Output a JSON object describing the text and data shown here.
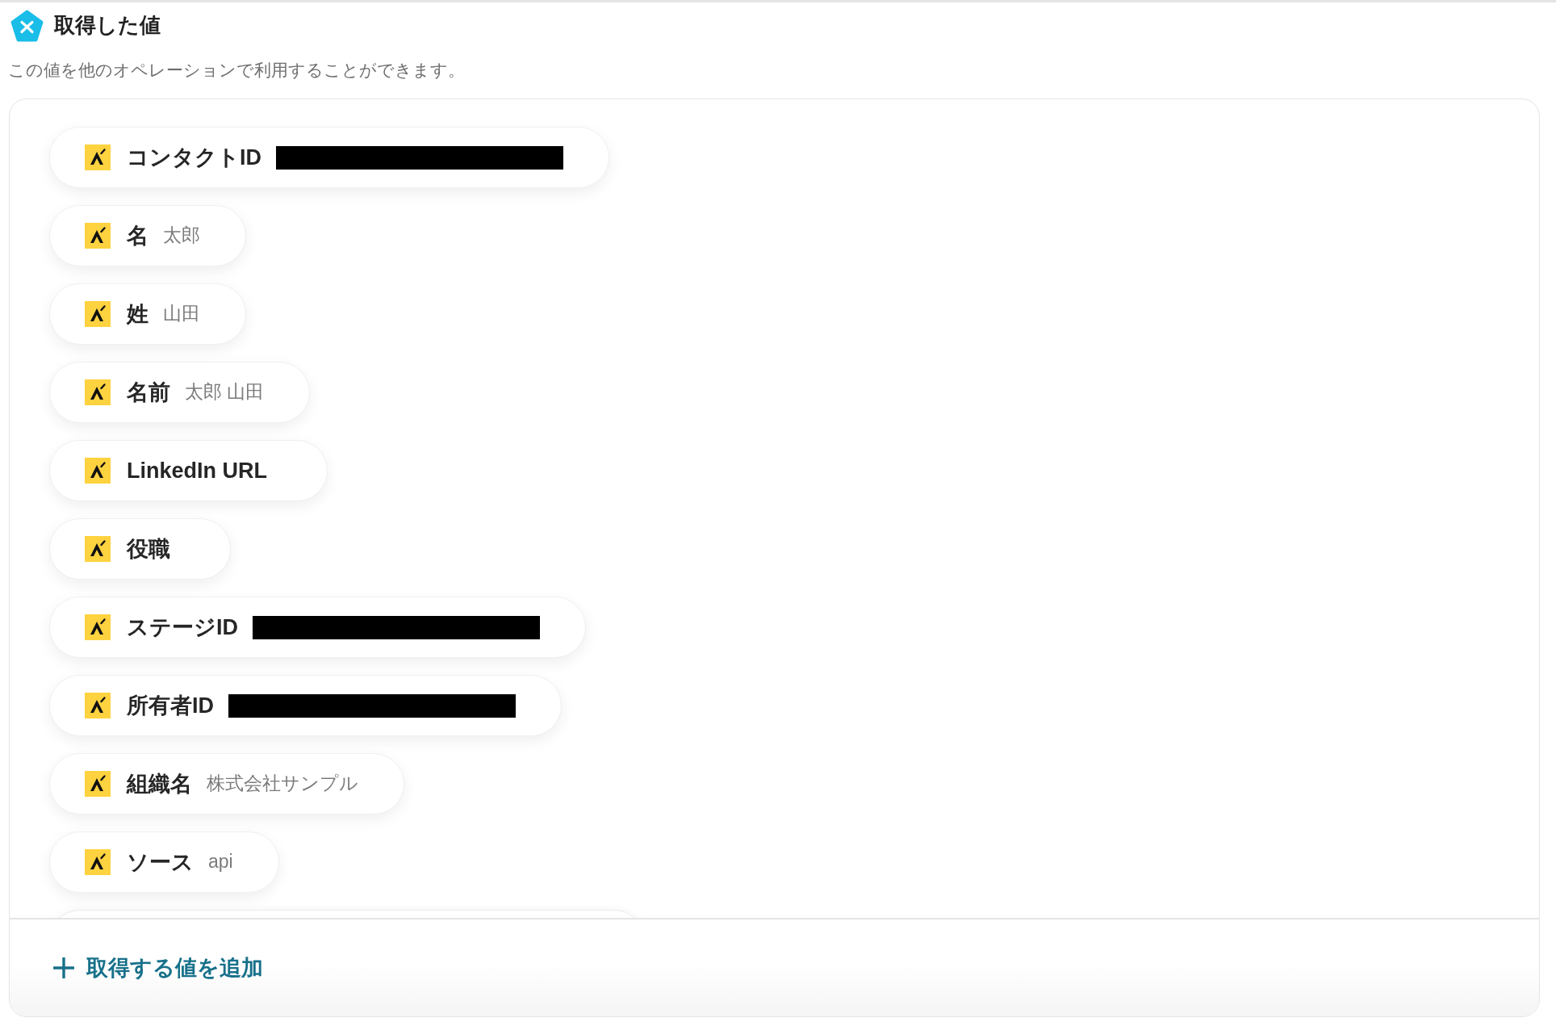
{
  "header": {
    "title": "取得した値",
    "description": "この値を他のオペレーションで利用することができます。"
  },
  "values": {
    "items": [
      {
        "label": "コンタクトID",
        "redacted": true
      },
      {
        "label": "名",
        "value": "太郎",
        "redacted": false
      },
      {
        "label": "姓",
        "value": "山田",
        "redacted": false
      },
      {
        "label": "名前",
        "value": "太郎 山田",
        "redacted": false
      },
      {
        "label": "LinkedIn URL",
        "redacted": false
      },
      {
        "label": "役職",
        "redacted": false
      },
      {
        "label": "ステージID",
        "redacted": true
      },
      {
        "label": "所有者ID",
        "redacted": true
      },
      {
        "label": "組織名",
        "value": "株式会社サンプル",
        "redacted": false
      },
      {
        "label": "ソース",
        "value": "api",
        "redacted": false
      }
    ],
    "more_below": true
  },
  "add_button": {
    "label": "取得する値を追加"
  }
}
